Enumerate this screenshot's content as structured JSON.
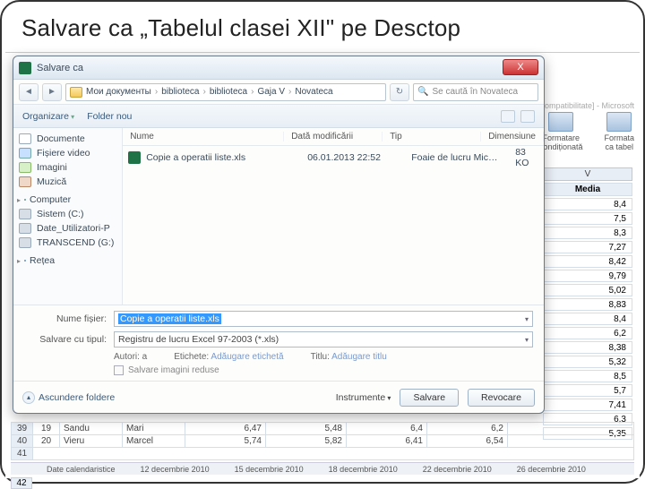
{
  "slide": {
    "title": "Salvare ca „Tabelul clasei XII\" pe Desctop"
  },
  "workbook": {
    "title_suffix": "ompatibilitate] - Microsoft"
  },
  "ribbon": {
    "cond": "Formatare\ncondiționată",
    "tbl": "Formata\nca tabel"
  },
  "dialog": {
    "title": "Salvare ca",
    "close": "X",
    "nav": {
      "crumbs": [
        "Мои документы",
        "biblioteca",
        "biblioteca",
        "Gaja V",
        "Novateca"
      ],
      "refresh": "↻",
      "search_placeholder": "Se caută în Novateca"
    },
    "toolbar": {
      "organize": "Organizare",
      "newfolder": "Folder nou"
    },
    "sidebar": {
      "items": [
        "Documente",
        "Fișiere video",
        "Imagini",
        "Muzică"
      ],
      "computer": "Computer",
      "drives": [
        "Sistem (C:)",
        "Date_Utilizatori-P",
        "TRANSCEND (G:)"
      ],
      "network": "Rețea"
    },
    "columns": {
      "name": "Nume",
      "date": "Dată modificării",
      "type": "Tip",
      "size": "Dimensiune"
    },
    "file": {
      "name": "Copie a operatii liste.xls",
      "date": "06.01.2013 22:52",
      "type": "Foaie de lucru Mic…",
      "size": "83 KO"
    },
    "fields": {
      "name_label": "Nume fișier:",
      "name_value": "Copie a operatii liste.xls",
      "type_label": "Salvare cu tipul:",
      "type_value": "Registru de lucru Excel 97-2003 (*.xls)",
      "authors_label": "Autori: a",
      "tags_label": "Etichete:",
      "tags_ph": "Adăugare etichetă",
      "title_label": "Titlu:",
      "title_ph": "Adăugare titlu",
      "thumb": "Salvare imagini reduse"
    },
    "footer": {
      "hide": "Ascundere foldere",
      "tools": "Instrumente",
      "save": "Salvare",
      "cancel": "Revocare"
    }
  },
  "sheet": {
    "col_letter": "V",
    "header": "Media",
    "values": [
      "8,4",
      "7,5",
      "8,3",
      "7,27",
      "8,42",
      "9,79",
      "5,02",
      "8,83",
      "8,4",
      "6,2",
      "8,38",
      "5,32",
      "8,5",
      "5,7",
      "7,41",
      "6,3",
      "5,35"
    ]
  },
  "bottom": {
    "r39": {
      "n": "39",
      "a": "19",
      "b": "Sandu",
      "c": "Mari",
      "d": "6,47",
      "e": "5,48",
      "f": "6,4",
      "g": "6,2"
    },
    "r40": {
      "n": "40",
      "a": "20",
      "b": "Vieru",
      "c": "Marcel",
      "d": "5,74",
      "e": "5,82",
      "f": "6,41",
      "g": "6,54"
    },
    "r41": {
      "n": "41"
    },
    "tabs": {
      "t1": "Date calendaristice",
      "t2": "12 decembrie 2010",
      "t3": "15 decembrie 2010",
      "t4": "18 decembrie 2010",
      "t5": "22 decembrie 2010",
      "t6": "26 decembrie 2010"
    },
    "r42": "42"
  }
}
